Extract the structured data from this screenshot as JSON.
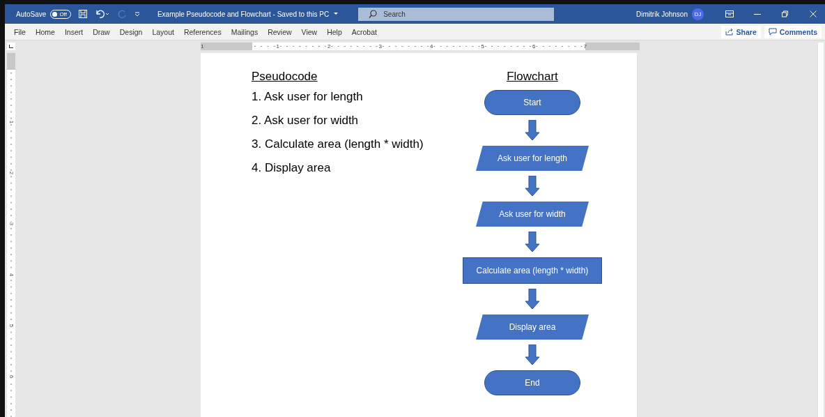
{
  "title_bar": {
    "autosave_label": "AutoSave",
    "autosave_toggle": {
      "label": "Off",
      "on": false
    },
    "document_title": "Example Pseudocode and Flowchart  -  Saved to this PC",
    "search_placeholder": "Search",
    "user_name": "Dimitrik Johnson",
    "user_initials": "DJ"
  },
  "menu": [
    {
      "label": "File"
    },
    {
      "label": "Home"
    },
    {
      "label": "Insert"
    },
    {
      "label": "Draw"
    },
    {
      "label": "Design"
    },
    {
      "label": "Layout"
    },
    {
      "label": "References"
    },
    {
      "label": "Mailings"
    },
    {
      "label": "Review"
    },
    {
      "label": "View"
    },
    {
      "label": "Help"
    },
    {
      "label": "Acrobat"
    }
  ],
  "share_button": "Share",
  "comments_button": "Comments",
  "ruler": {
    "labels": [
      "1",
      "1",
      "2",
      "3",
      "4",
      "5",
      "6",
      "7"
    ]
  },
  "vertical_ruler": {
    "labels": [
      "1",
      "2",
      "3",
      "4",
      "5",
      "6"
    ]
  },
  "document": {
    "pseudocode_heading": "Pseudocode",
    "steps": [
      "1. Ask user for length",
      "2. Ask user for width",
      "3. Calculate area (length * width)",
      "4. Display area"
    ],
    "flowchart_heading": "Flowchart",
    "flowchart": [
      {
        "kind": "terminator",
        "label": "Start"
      },
      {
        "kind": "io",
        "label": "Ask user for length"
      },
      {
        "kind": "io",
        "label": "Ask user for width"
      },
      {
        "kind": "process",
        "label": "Calculate area (length * width)"
      },
      {
        "kind": "io",
        "label": "Display area"
      },
      {
        "kind": "terminator",
        "label": "End"
      }
    ]
  }
}
